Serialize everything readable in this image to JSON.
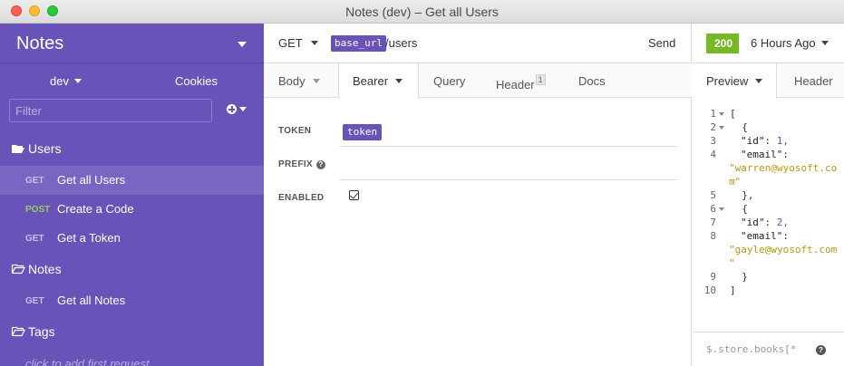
{
  "window": {
    "title": "Notes (dev) – Get all Users"
  },
  "sidebar": {
    "workspace": "Notes",
    "environment": "dev",
    "cookies_label": "Cookies",
    "filter_placeholder": "Filter",
    "folders": [
      {
        "label": "Users",
        "requests": [
          {
            "method": "GET",
            "label": "Get all Users",
            "active": true
          },
          {
            "method": "POST",
            "label": "Create a Code"
          },
          {
            "method": "GET",
            "label": "Get a Token"
          }
        ]
      },
      {
        "label": "Notes",
        "requests": [
          {
            "method": "GET",
            "label": "Get all Notes"
          }
        ]
      },
      {
        "label": "Tags",
        "requests": []
      }
    ],
    "empty_hint": "click to add first request..."
  },
  "request": {
    "method": "GET",
    "url_var": "base_url",
    "url_path": "/users",
    "send_label": "Send",
    "tabs": [
      {
        "label": "Body"
      },
      {
        "label": "Bearer"
      },
      {
        "label": "Query"
      },
      {
        "label": "Header",
        "badge": "1"
      },
      {
        "label": "Docs"
      }
    ],
    "auth": {
      "token_label": "TOKEN",
      "token_value": "token",
      "prefix_label": "PREFIX",
      "prefix_help": "?",
      "enabled_label": "ENABLED",
      "enabled": true
    }
  },
  "response": {
    "status": "200",
    "time": "6 Hours Ago",
    "tabs": [
      {
        "label": "Preview"
      },
      {
        "label": "Header"
      }
    ],
    "lines": [
      {
        "n": "1",
        "text": "["
      },
      {
        "n": "2",
        "text": "  {"
      },
      {
        "n": "3",
        "key": "\"id\"",
        "value": "1,"
      },
      {
        "n": "4",
        "key": "\"email\"",
        "value": ":"
      },
      {
        "n": "",
        "text": "\"warren@wyosoft.co"
      },
      {
        "n": "",
        "text": "m\""
      },
      {
        "n": "5",
        "text": "  },"
      },
      {
        "n": "6",
        "text": "  {"
      },
      {
        "n": "7",
        "key": "\"id\"",
        "value": "2,"
      },
      {
        "n": "8",
        "key": "\"email\"",
        "value": ":"
      },
      {
        "n": "",
        "text": "\"gayle@wyosoft.com"
      },
      {
        "n": "",
        "text": "\""
      },
      {
        "n": "9",
        "text": "  }"
      },
      {
        "n": "10",
        "text": "]"
      }
    ],
    "filter_placeholder": "$.store.books[*",
    "help": "?"
  },
  "colors": {
    "sidebar": "#6952b8",
    "status_ok": "#75ba24",
    "accent": "#6952b8"
  }
}
